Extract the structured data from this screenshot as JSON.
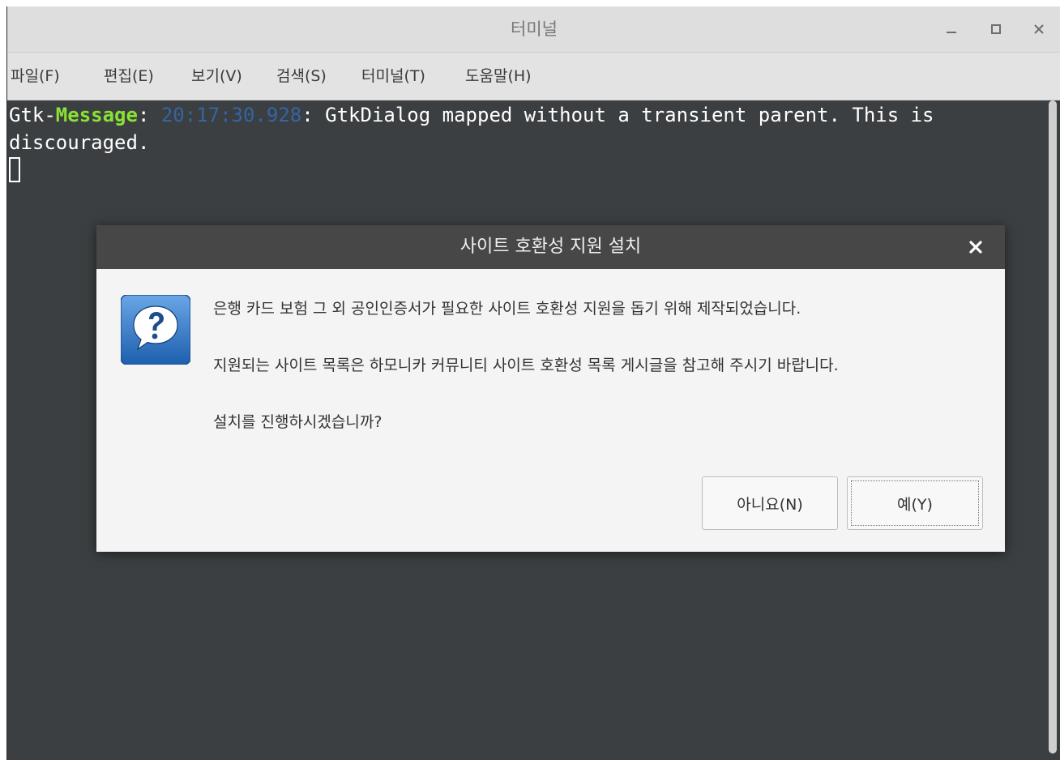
{
  "window": {
    "title": "터미널",
    "controls": {
      "minimize": "minimize-icon",
      "maximize": "maximize-icon",
      "close": "close-icon"
    }
  },
  "menu": {
    "items": [
      {
        "label": "파일(F)"
      },
      {
        "label": "편집(E)"
      },
      {
        "label": "보기(V)"
      },
      {
        "label": "검색(S)"
      },
      {
        "label": "터미널(T)"
      },
      {
        "label": "도움말(H)"
      }
    ]
  },
  "terminal": {
    "prefix": "Gtk-",
    "msg_label": "Message",
    "colon": ": ",
    "timestamp": "20:17:30.928",
    "text": ": GtkDialog mapped without a transient parent. This is",
    "line2": "discouraged.",
    "colors": {
      "message": "#8ae234",
      "timestamp": "#3465a4",
      "background": "#3c3f41"
    }
  },
  "dialog": {
    "title": "사이트 호환성 지원 설치",
    "icon": "question-icon",
    "line1": "은행 카드 보험 그 외 공인인증서가 필요한 사이트 호환성 지원을 돕기 위해 제작되었습니다.",
    "line2": "지원되는 사이트 목록은 하모니카 커뮤니티 사이트 호환성 목록 게시글을 참고해 주시기 바랍니다.",
    "line3": "설치를 진행하시겠습니까?",
    "no_label": "아니요(N)",
    "yes_label": "예(Y)"
  }
}
